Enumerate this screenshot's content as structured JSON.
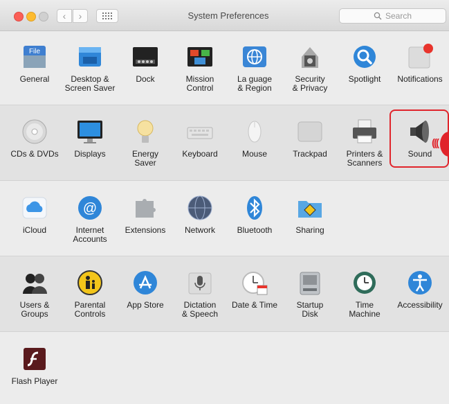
{
  "window": {
    "title": "System Preferences",
    "search_placeholder": "Search"
  },
  "colors": {
    "highlight": "#e0242b",
    "close": "#fb5f57",
    "minimize": "#fdbb2f",
    "zoom_disabled": "#d0d0d0"
  },
  "rows": [
    {
      "items": [
        {
          "label": "General",
          "icon": "general-icon"
        },
        {
          "label": "Desktop &\nScreen Saver",
          "icon": "desktop-icon"
        },
        {
          "label": "Dock",
          "icon": "dock-icon"
        },
        {
          "label": "Mission\nControl",
          "icon": "mission-control-icon"
        },
        {
          "label": "La  guage\n& Region",
          "icon": "language-region-icon"
        },
        {
          "label": "Security\n& Privacy",
          "icon": "security-icon"
        },
        {
          "label": "Spotlight",
          "icon": "spotlight-icon"
        },
        {
          "label": "Notifications",
          "icon": "notifications-icon"
        }
      ]
    },
    {
      "items": [
        {
          "label": "CDs & DVDs",
          "icon": "cd-icon"
        },
        {
          "label": "Displays",
          "icon": "displays-icon"
        },
        {
          "label": "Energy\nSaver",
          "icon": "energy-icon"
        },
        {
          "label": "Keyboard",
          "icon": "keyboard-icon"
        },
        {
          "label": "Mouse",
          "icon": "mouse-icon"
        },
        {
          "label": "Trackpad",
          "icon": "trackpad-icon"
        },
        {
          "label": "Printers &\nScanners",
          "icon": "printer-icon"
        },
        {
          "label": "Sound",
          "icon": "sound-icon"
        }
      ]
    },
    {
      "items": [
        {
          "label": "iCloud",
          "icon": "icloud-icon"
        },
        {
          "label": "Internet\nAccounts",
          "icon": "internet-accounts-icon"
        },
        {
          "label": "Extensions",
          "icon": "extensions-icon"
        },
        {
          "label": "Network",
          "icon": "network-icon"
        },
        {
          "label": "Bluetooth",
          "icon": "bluetooth-icon"
        },
        {
          "label": "Sharing",
          "icon": "sharing-icon"
        }
      ]
    },
    {
      "items": [
        {
          "label": "Users &\nGroups",
          "icon": "users-icon"
        },
        {
          "label": "Parental\nControls",
          "icon": "parental-icon"
        },
        {
          "label": "App Store",
          "icon": "app-store-icon"
        },
        {
          "label": "Dictation\n& Speech",
          "icon": "dictation-icon"
        },
        {
          "label": "Date & Time",
          "icon": "date-time-icon"
        },
        {
          "label": "Startup\nDisk",
          "icon": "startup-disk-icon"
        },
        {
          "label": "Time\nMachine",
          "icon": "time-machine-icon"
        },
        {
          "label": "Accessibility",
          "icon": "accessibility-icon"
        }
      ]
    },
    {
      "items": [
        {
          "label": "Flash Player",
          "icon": "flash-icon"
        }
      ]
    }
  ]
}
